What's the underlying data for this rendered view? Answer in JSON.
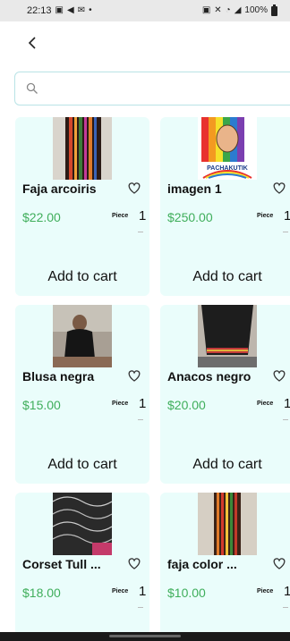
{
  "status_bar": {
    "time": "22:13",
    "battery_label": "100%",
    "left_icons": [
      "gallery-icon",
      "telegram-icon",
      "gmail-icon",
      "dot-icon"
    ],
    "right_icons": [
      "photo-icon",
      "mute-icon",
      "wifi-icon",
      "signal-icon",
      "battery-icon"
    ]
  },
  "header": {
    "back_icon": "chevron-left-icon"
  },
  "search": {
    "placeholder": "",
    "value": ""
  },
  "products": [
    {
      "name": "Faja arcoiris",
      "price": "$22.00",
      "unit": "Piece",
      "qty": "1",
      "cta": "Add to cart"
    },
    {
      "name": "imagen  1",
      "price": "$250.00",
      "unit": "Piece",
      "qty": "1",
      "cta": "Add to cart"
    },
    {
      "name": "Blusa negra",
      "price": "$15.00",
      "unit": "Piece",
      "qty": "1",
      "cta": "Add to cart"
    },
    {
      "name": "Anacos negro",
      "price": "$20.00",
      "unit": "Piece",
      "qty": "1",
      "cta": "Add to cart"
    },
    {
      "name": "Corset Tull ...",
      "price": "$18.00",
      "unit": "Piece",
      "qty": "1",
      "cta": ""
    },
    {
      "name": "faja color ...",
      "price": "$10.00",
      "unit": "Piece",
      "qty": "1",
      "cta": ""
    }
  ],
  "logo_text": "PACHAKUTIK",
  "colors": {
    "card_bg": "#eafdfb",
    "price": "#3fae5b",
    "search_border": "#b9e3e6"
  }
}
